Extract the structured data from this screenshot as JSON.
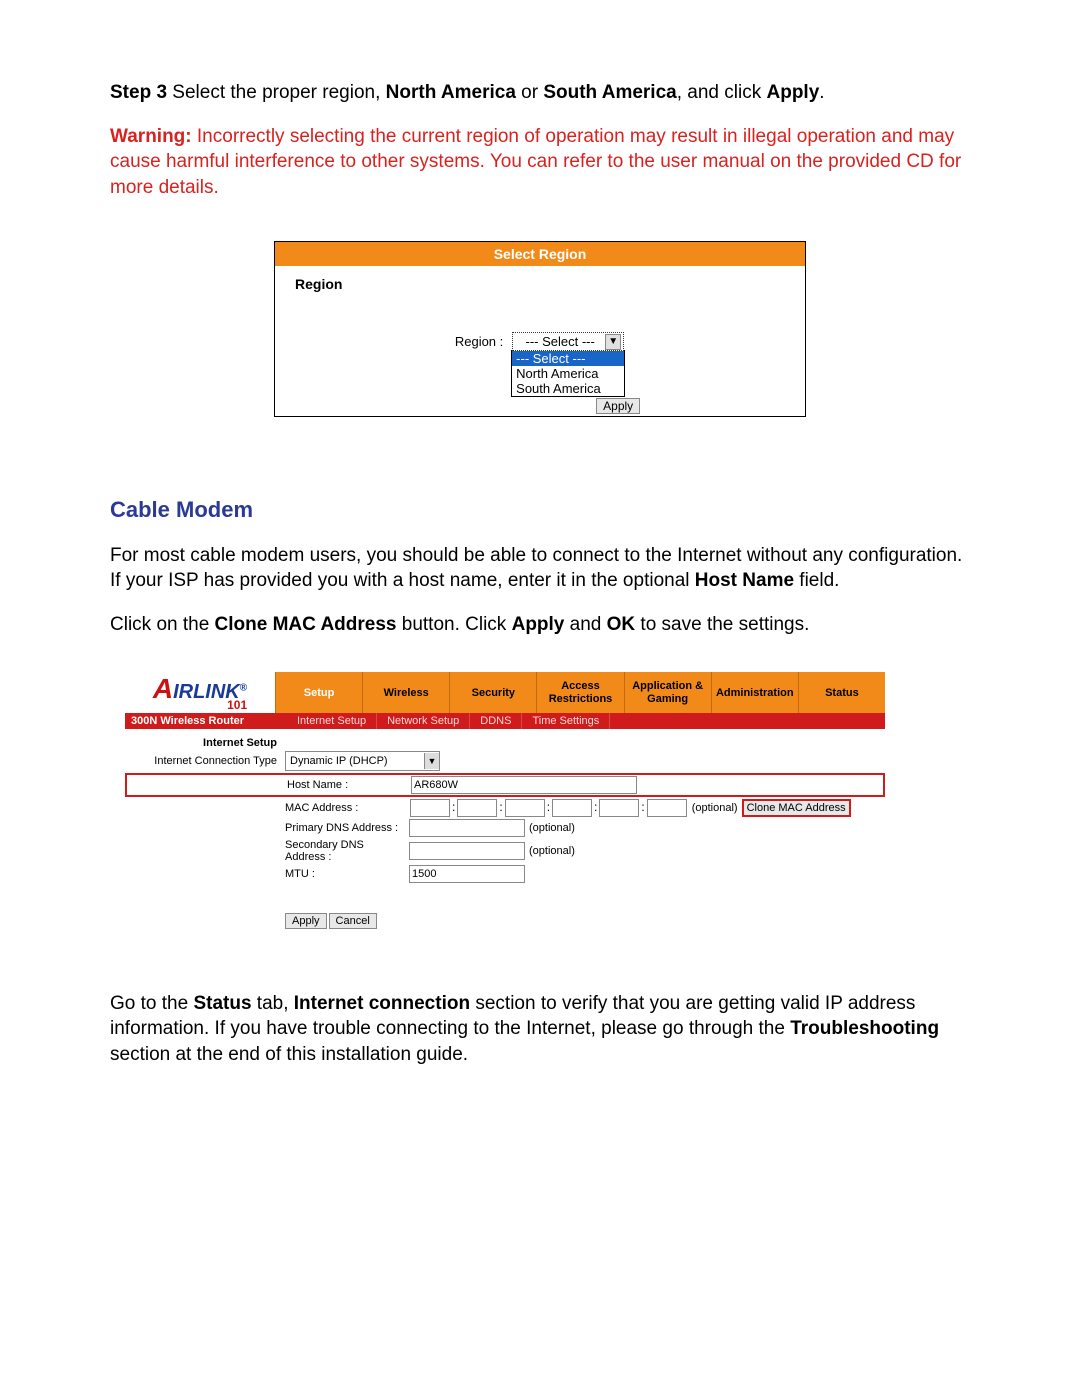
{
  "step3": {
    "prefix": "Step 3",
    "text_a": " Select the proper region, ",
    "north_america": "North America",
    "or": " or ",
    "south_america": "South America",
    "text_b": ", and click ",
    "apply": "Apply",
    "period": "."
  },
  "warning": {
    "label": "Warning:",
    "text": " Incorrectly selecting the current region of operation may result in illegal operation and may cause harmful interference to other systems. You can refer to the user manual on the provided CD for more details."
  },
  "region_box": {
    "header": "Select Region",
    "left_label": "Region",
    "field_label": "Region :",
    "selected": "--- Select ---",
    "options": [
      "--- Select ---",
      "North America",
      "South America"
    ],
    "apply_btn": "Apply"
  },
  "cable_modem": {
    "heading": "Cable  Modem",
    "p1_a": "For most cable modem users, you should be able to connect to the Internet without any configuration. If your ISP has provided you with a host name, enter it in the optional ",
    "p1_bold": "Host Name",
    "p1_b": " field.",
    "p2_a": "Click on the ",
    "p2_bold1": "Clone MAC Address",
    "p2_b": " button. Click ",
    "p2_bold2": "Apply",
    "p2_c": " and ",
    "p2_bold3": "OK",
    "p2_d": " to save the settings."
  },
  "router": {
    "logo_text": "IRLINK",
    "logo_101": "101",
    "tabs": [
      "Setup",
      "Wireless",
      "Security",
      "Access Restrictions",
      "Application & Gaming",
      "Administration",
      "Status"
    ],
    "active_tab_index": 0,
    "model": "300N Wireless Router",
    "subtabs": [
      "Internet Setup",
      "Network Setup",
      "DDNS",
      "Time Settings"
    ],
    "section": "Internet Setup",
    "conn_type_label": "Internet Connection Type",
    "conn_type_value": "Dynamic IP (DHCP)",
    "host_name_label": "Host Name :",
    "host_name_value": "AR680W",
    "mac_label": "MAC Address :",
    "optional": "(optional)",
    "primary_dns_label": "Primary DNS Address :",
    "secondary_dns_label": "Secondary DNS Address :",
    "mtu_label": "MTU :",
    "mtu_value": "1500",
    "clone_btn": "Clone MAC Address",
    "apply_btn": "Apply",
    "cancel_btn": "Cancel"
  },
  "footer": {
    "a": "Go to the ",
    "b1": "Status",
    "b": " tab, ",
    "b2": "Internet connection",
    "c": " section to verify that you are getting valid IP address information.  If you have trouble connecting to the Internet, please go through the ",
    "b3": "Troubleshooting",
    "d": " section at the end of this installation guide."
  }
}
